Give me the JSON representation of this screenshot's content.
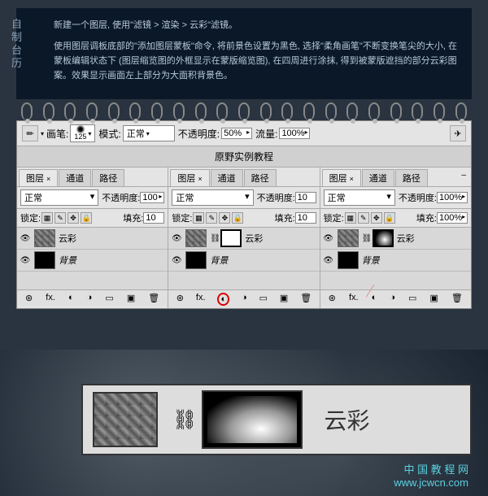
{
  "header": {
    "vtitle": "自制台历",
    "line1": "新建一个图层, 使用\"滤镜 > 渲染 > 云彩\"滤镜。",
    "line2": "使用图层调板底部的\"添加图层蒙板\"命令, 将前景色设置为黑色, 选择\"柔角画笔\"不断变换笔尖的大小, 在蒙板编辑状态下 (图层缩览图的外框显示在蒙版缩览图), 在四周进行涂抹, 得到被蒙版遮挡的部分云彩图案。效果显示画面左上部分为大面积背景色。"
  },
  "brushbar": {
    "brush_label": "画笔:",
    "brush_size": "125",
    "mode_label": "模式:",
    "mode_value": "正常",
    "opacity_label": "不透明度:",
    "opacity_value": "50%",
    "flow_label": "流量:",
    "flow_value": "100%"
  },
  "title_row": "原野实例教程",
  "tabs": {
    "layers": "图层",
    "channels": "通道",
    "paths": "路径"
  },
  "panel": {
    "blend": "正常",
    "opacity_label": "不透明度:",
    "opacity_val": "100",
    "opacity_short": "10",
    "lock_label": "锁定:",
    "fill_label": "填充:",
    "fill_val": "100%"
  },
  "layers": {
    "cloud": "云彩",
    "bg": "背景"
  },
  "zoom_label": "云彩",
  "watermark": {
    "l1": "中 国 教 程 网",
    "l2": "www.jcwcn.com"
  }
}
